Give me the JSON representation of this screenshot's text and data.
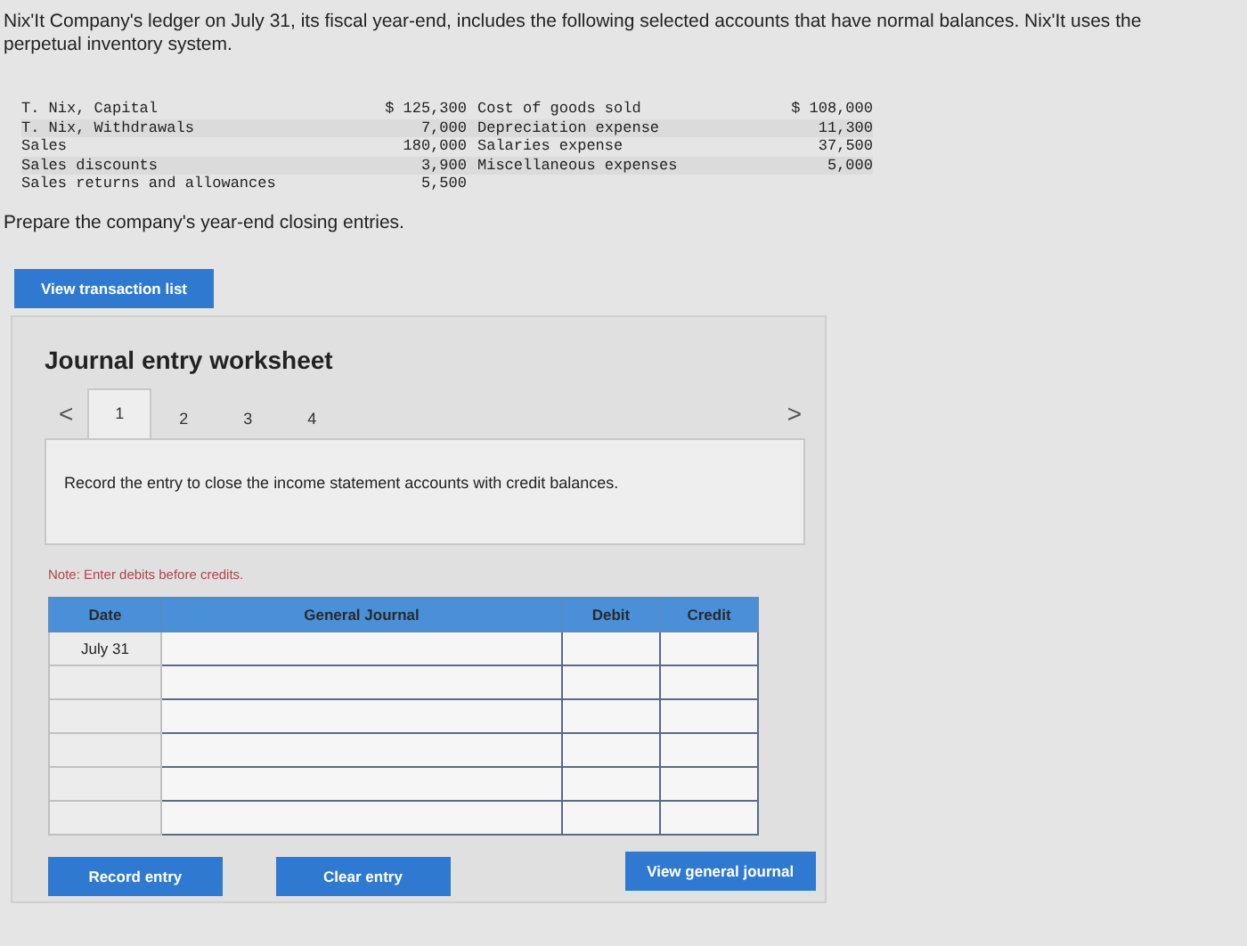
{
  "intro": "Nix'It Company's ledger on July 31, its fiscal year-end, includes the following selected accounts that have normal balances. Nix'It uses the perpetual inventory system.",
  "accounts": [
    [
      {
        "name": "T. Nix, Capital",
        "amount": "$ 125,300"
      },
      {
        "name": "T. Nix, Withdrawals",
        "amount": "7,000"
      },
      {
        "name": "Sales",
        "amount": "180,000"
      },
      {
        "name": "Sales discounts",
        "amount": "3,900"
      },
      {
        "name": "Sales returns and allowances",
        "amount": "5,500"
      }
    ],
    [
      {
        "name": "Cost of goods sold",
        "amount": "$ 108,000"
      },
      {
        "name": "Depreciation expense",
        "amount": "11,300"
      },
      {
        "name": "Salaries expense",
        "amount": "37,500"
      },
      {
        "name": "Miscellaneous expenses",
        "amount": "5,000"
      }
    ]
  ],
  "task": "Prepare the company's year-end closing entries.",
  "transaction_button": "View transaction list",
  "worksheet": {
    "title": "Journal entry worksheet",
    "prev": "<",
    "next": ">",
    "tabs": [
      {
        "label": "1",
        "selected": true
      },
      {
        "label": "2",
        "selected": false
      },
      {
        "label": "3",
        "selected": false
      },
      {
        "label": "4",
        "selected": false
      }
    ],
    "instruction": "Record the entry to close the income statement accounts with credit balances.",
    "note": "Note: Enter debits before credits.",
    "columns": [
      "Date",
      "General Journal",
      "Debit",
      "Credit"
    ],
    "rows": [
      {
        "date": "July 31"
      },
      {},
      {},
      {},
      {},
      {}
    ],
    "buttons": [
      "Record entry",
      "Clear entry",
      "View general journal"
    ]
  }
}
